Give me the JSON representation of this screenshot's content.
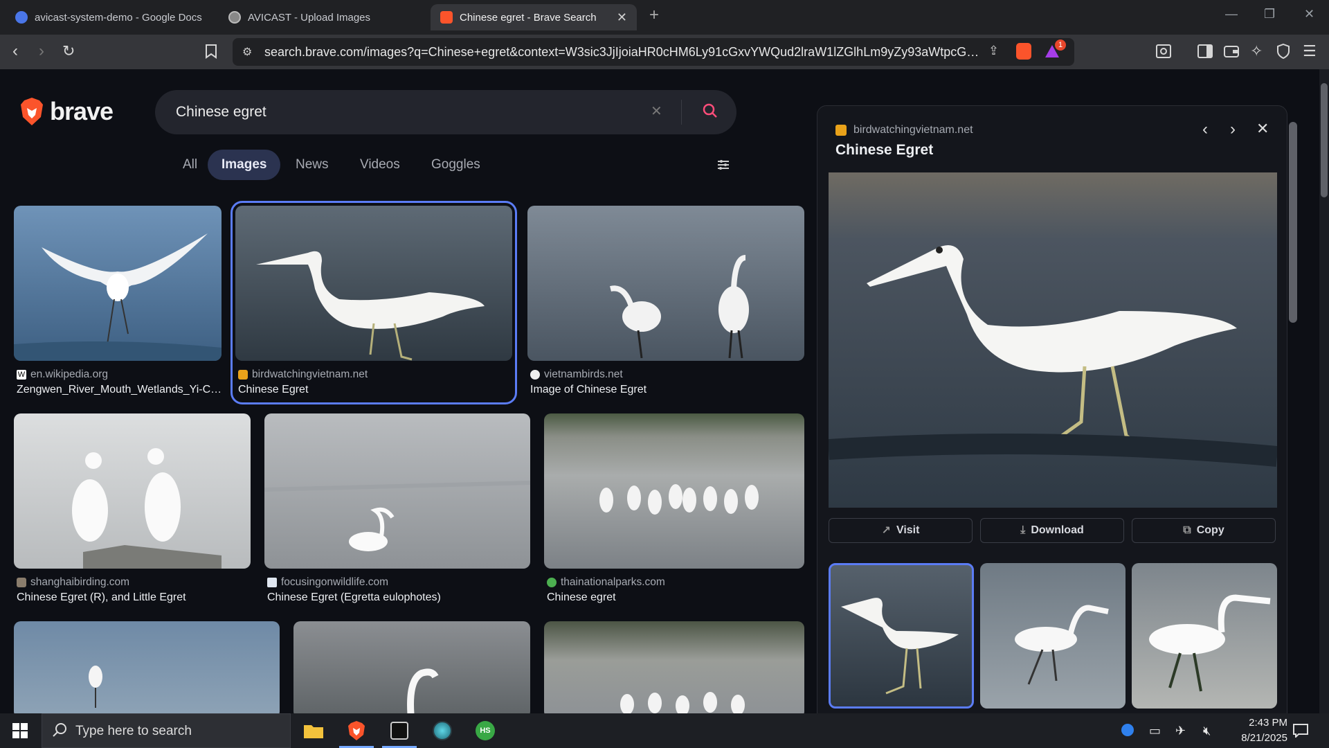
{
  "tabs": [
    {
      "title": "avicast-system-demo - Google Docs",
      "icon": "google-docs-icon"
    },
    {
      "title": "AVICAST - Upload Images",
      "icon": "globe-icon"
    },
    {
      "title": "Chinese egret - Brave Search",
      "icon": "brave-icon"
    }
  ],
  "address": {
    "url": "search.brave.com/images?q=Chinese+egret&context=W3sic3JjIjoiaHR0cHM6Ly91cGxvYWQud2lraW1lZGlhLm9yZy93aWtpcGVkaWEvY29tbW9ucy9..."
  },
  "brand": {
    "name": "brave"
  },
  "search": {
    "query": "Chinese egret"
  },
  "nav_tabs": [
    {
      "label": "All"
    },
    {
      "label": "Images"
    },
    {
      "label": "News"
    },
    {
      "label": "Videos"
    },
    {
      "label": "Goggles"
    }
  ],
  "results": [
    {
      "source": "en.wikipedia.org",
      "title": "Zengwen_River_Mouth_Wetlands_Yi-Ch..."
    },
    {
      "source": "birdwatchingvietnam.net",
      "title": "Chinese Egret"
    },
    {
      "source": "vietnambirds.net",
      "title": "Image of Chinese Egret"
    },
    {
      "source": "shanghaibirding.com",
      "title": "Chinese Egret (R), and Little Egret"
    },
    {
      "source": "focusingonwildlife.com",
      "title": "Chinese Egret (Egretta eulophotes)"
    },
    {
      "source": "thainationalparks.com",
      "title": "Chinese egret"
    }
  ],
  "panel": {
    "source": "birdwatchingvietnam.net",
    "title": "Chinese Egret",
    "visit_label": "Visit",
    "download_label": "Download",
    "copy_label": "Copy"
  },
  "taskbar": {
    "search_placeholder": "Type here to search",
    "time": "2:43 PM",
    "date": "8/21/2025"
  },
  "notification_count": "1",
  "colors": {
    "accent": "#5b7cf5",
    "brave_orange": "#fb542b",
    "background": "#0d0f15"
  }
}
